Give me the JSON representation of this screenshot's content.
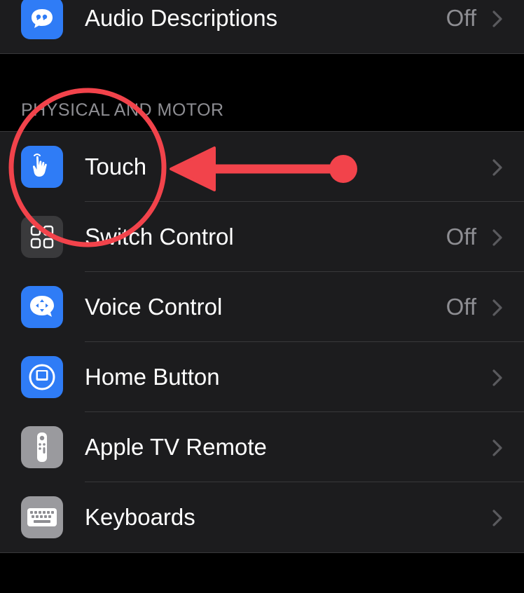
{
  "top_group": {
    "audio_descriptions": {
      "label": "Audio Descriptions",
      "value": "Off",
      "icon": "speech-bubble-quote-icon",
      "icon_color": "#2f7cf6"
    }
  },
  "section": {
    "header": "PHYSICAL AND MOTOR"
  },
  "rows": [
    {
      "label": "Touch",
      "value": "",
      "icon": "hand-touch-icon",
      "icon_color": "#2f7cf6"
    },
    {
      "label": "Switch Control",
      "value": "Off",
      "icon": "grid-squares-icon",
      "icon_color": "#3a3a3c"
    },
    {
      "label": "Voice Control",
      "value": "Off",
      "icon": "voice-control-icon",
      "icon_color": "#2f7cf6"
    },
    {
      "label": "Home Button",
      "value": "",
      "icon": "home-button-icon",
      "icon_color": "#2f7cf6"
    },
    {
      "label": "Apple TV Remote",
      "value": "",
      "icon": "tv-remote-icon",
      "icon_color": "#9a9a9e"
    },
    {
      "label": "Keyboards",
      "value": "",
      "icon": "keyboard-icon",
      "icon_color": "#9a9a9e"
    }
  ],
  "colors": {
    "background": "#000000",
    "cell": "#1c1c1e",
    "separator": "#38383a",
    "annotation_red": "#f2434b"
  }
}
